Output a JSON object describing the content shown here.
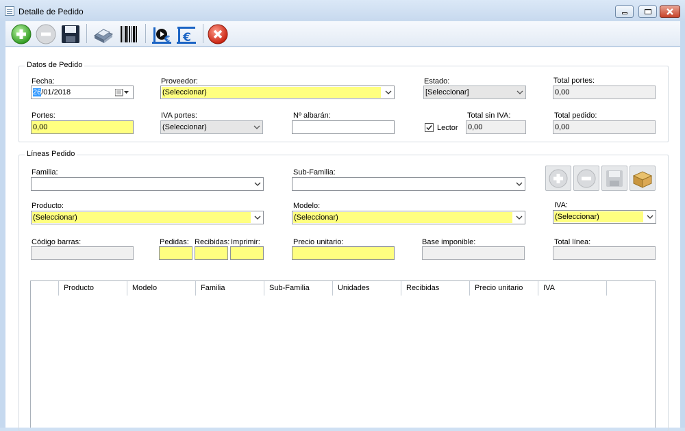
{
  "window": {
    "title": "Detalle de Pedido"
  },
  "toolbar": {
    "buttons": [
      {
        "name": "add",
        "icon": "plus-circle-icon"
      },
      {
        "name": "remove",
        "icon": "minus-circle-icon"
      },
      {
        "name": "save",
        "icon": "floppy-disk-icon"
      },
      {
        "name": "print",
        "icon": "printer-icon"
      },
      {
        "name": "barcode",
        "icon": "barcode-icon"
      },
      {
        "name": "play-euro",
        "icon": "euro-play-icon"
      },
      {
        "name": "euro",
        "icon": "euro-report-icon"
      },
      {
        "name": "close",
        "icon": "close-circle-icon"
      }
    ]
  },
  "order": {
    "group_title": "Datos de Pedido",
    "fecha_label": "Fecha:",
    "fecha_day": "26",
    "fecha_rest": "/01/2018",
    "proveedor_label": "Proveedor:",
    "proveedor_value": "(Seleccionar)",
    "estado_label": "Estado:",
    "estado_value": "[Seleccionar]",
    "total_portes_label": "Total portes:",
    "total_portes_value": "0,00",
    "portes_label": "Portes:",
    "portes_value": "0,00",
    "iva_portes_label": "IVA portes:",
    "iva_portes_value": "(Seleccionar)",
    "albaran_label": "Nº albarán:",
    "albaran_value": "",
    "lector_label": "Lector",
    "lector_checked": true,
    "total_sin_iva_label": "Total sin IVA:",
    "total_sin_iva_value": "0,00",
    "total_pedido_label": "Total pedido:",
    "total_pedido_value": "0,00"
  },
  "lines": {
    "group_title": "Líneas Pedido",
    "familia_label": "Familia:",
    "familia_value": "",
    "subfamilia_label": "Sub-Familia:",
    "subfamilia_value": "",
    "producto_label": "Producto:",
    "producto_value": "(Seleccionar)",
    "modelo_label": "Modelo:",
    "modelo_value": "(Seleccionar)",
    "iva_label": "IVA:",
    "iva_value": "(Seleccionar)",
    "codigo_label": "Código barras:",
    "pedidas_label": "Pedidas:",
    "recibidas_label": "Recibidas:",
    "imprimir_label": "Imprimir:",
    "precio_label": "Precio unitario:",
    "base_label": "Base imponible:",
    "total_linea_label": "Total línea:",
    "buttons": [
      {
        "name": "add-line",
        "icon": "plus-circle-icon"
      },
      {
        "name": "remove-line",
        "icon": "minus-circle-icon"
      },
      {
        "name": "save-line",
        "icon": "floppy-disk-icon"
      },
      {
        "name": "open-box",
        "icon": "box-icon"
      }
    ]
  },
  "grid": {
    "columns": [
      "",
      "Producto",
      "Modelo",
      "Familia",
      "Sub-Familia",
      "Unidades",
      "Recibidas",
      "Precio unitario",
      "IVA"
    ],
    "rows": []
  }
}
